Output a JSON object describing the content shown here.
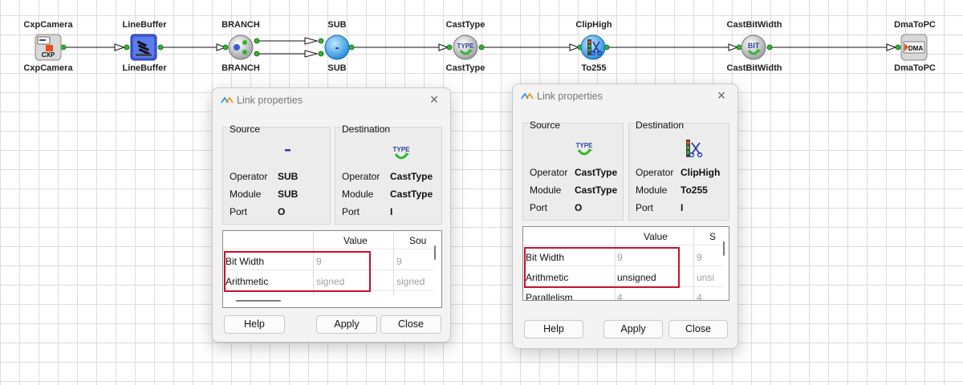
{
  "pipeline": {
    "nodes": [
      {
        "id": "cxpcamera",
        "top_label": "CxpCamera",
        "bottom_label": "CxpCamera",
        "icon": "cxp-camera-icon"
      },
      {
        "id": "linebuffer",
        "top_label": "LineBuffer",
        "bottom_label": "LineBuffer",
        "icon": "line-buffer-icon"
      },
      {
        "id": "branch",
        "top_label": "BRANCH",
        "bottom_label": "BRANCH",
        "icon": "branch-icon"
      },
      {
        "id": "sub",
        "top_label": "SUB",
        "bottom_label": "SUB",
        "icon": "subtract-icon"
      },
      {
        "id": "casttype",
        "top_label": "CastType",
        "bottom_label": "CastType",
        "icon": "cast-type-icon"
      },
      {
        "id": "cliphigh",
        "top_label": "ClipHigh",
        "bottom_label": "To255",
        "icon": "clip-high-icon"
      },
      {
        "id": "castbitwidth",
        "top_label": "CastBitWidth",
        "bottom_label": "CastBitWidth",
        "icon": "cast-bit-width-icon"
      },
      {
        "id": "dmatopc",
        "top_label": "DmaToPC",
        "bottom_label": "DmaToPC",
        "icon": "dma-to-pc-icon"
      }
    ],
    "icon_text": {
      "cxp": "CXP",
      "type": "TYPE",
      "bit": "BIT",
      "dma": "DMA",
      "minus": "-"
    }
  },
  "dialog1": {
    "title": "Link properties",
    "source": {
      "heading": "Source",
      "icon": "minus-icon",
      "operator_label": "Operator",
      "operator": "SUB",
      "module_label": "Module",
      "module": "SUB",
      "port_label": "Port",
      "port": "O"
    },
    "destination": {
      "heading": "Destination",
      "icon": "type-icon",
      "operator_label": "Operator",
      "operator": "CastType",
      "module_label": "Module",
      "module": "CastType",
      "port_label": "Port",
      "port": "I"
    },
    "table": {
      "headers": [
        "Value",
        "Sou"
      ],
      "rows": [
        {
          "name": "Bit Width",
          "value": "9",
          "source": "9"
        },
        {
          "name": "Arithmetic",
          "value": "signed",
          "source": "signed"
        }
      ]
    },
    "buttons": {
      "help": "Help",
      "apply": "Apply",
      "close": "Close"
    }
  },
  "dialog2": {
    "title": "Link properties",
    "source": {
      "heading": "Source",
      "icon": "type-icon",
      "operator_label": "Operator",
      "operator": "CastType",
      "module_label": "Module",
      "module": "CastType",
      "port_label": "Port",
      "port": "O"
    },
    "destination": {
      "heading": "Destination",
      "icon": "clip-icon",
      "operator_label": "Operator",
      "operator": "ClipHigh",
      "module_label": "Module",
      "module": "To255",
      "port_label": "Port",
      "port": "I"
    },
    "table": {
      "headers": [
        "Value",
        "S"
      ],
      "rows": [
        {
          "name": "Bit Width",
          "value": "9",
          "source": "9"
        },
        {
          "name": "Arithmetic",
          "value": "unsigned",
          "source": "unsi"
        },
        {
          "name": "Parallelism",
          "value": "4",
          "source": "4"
        }
      ]
    },
    "buttons": {
      "help": "Help",
      "apply": "Apply",
      "close": "Close"
    }
  },
  "colors": {
    "highlight": "#c8102e",
    "port": "#2fb52f",
    "accent": "#1e90ff"
  }
}
